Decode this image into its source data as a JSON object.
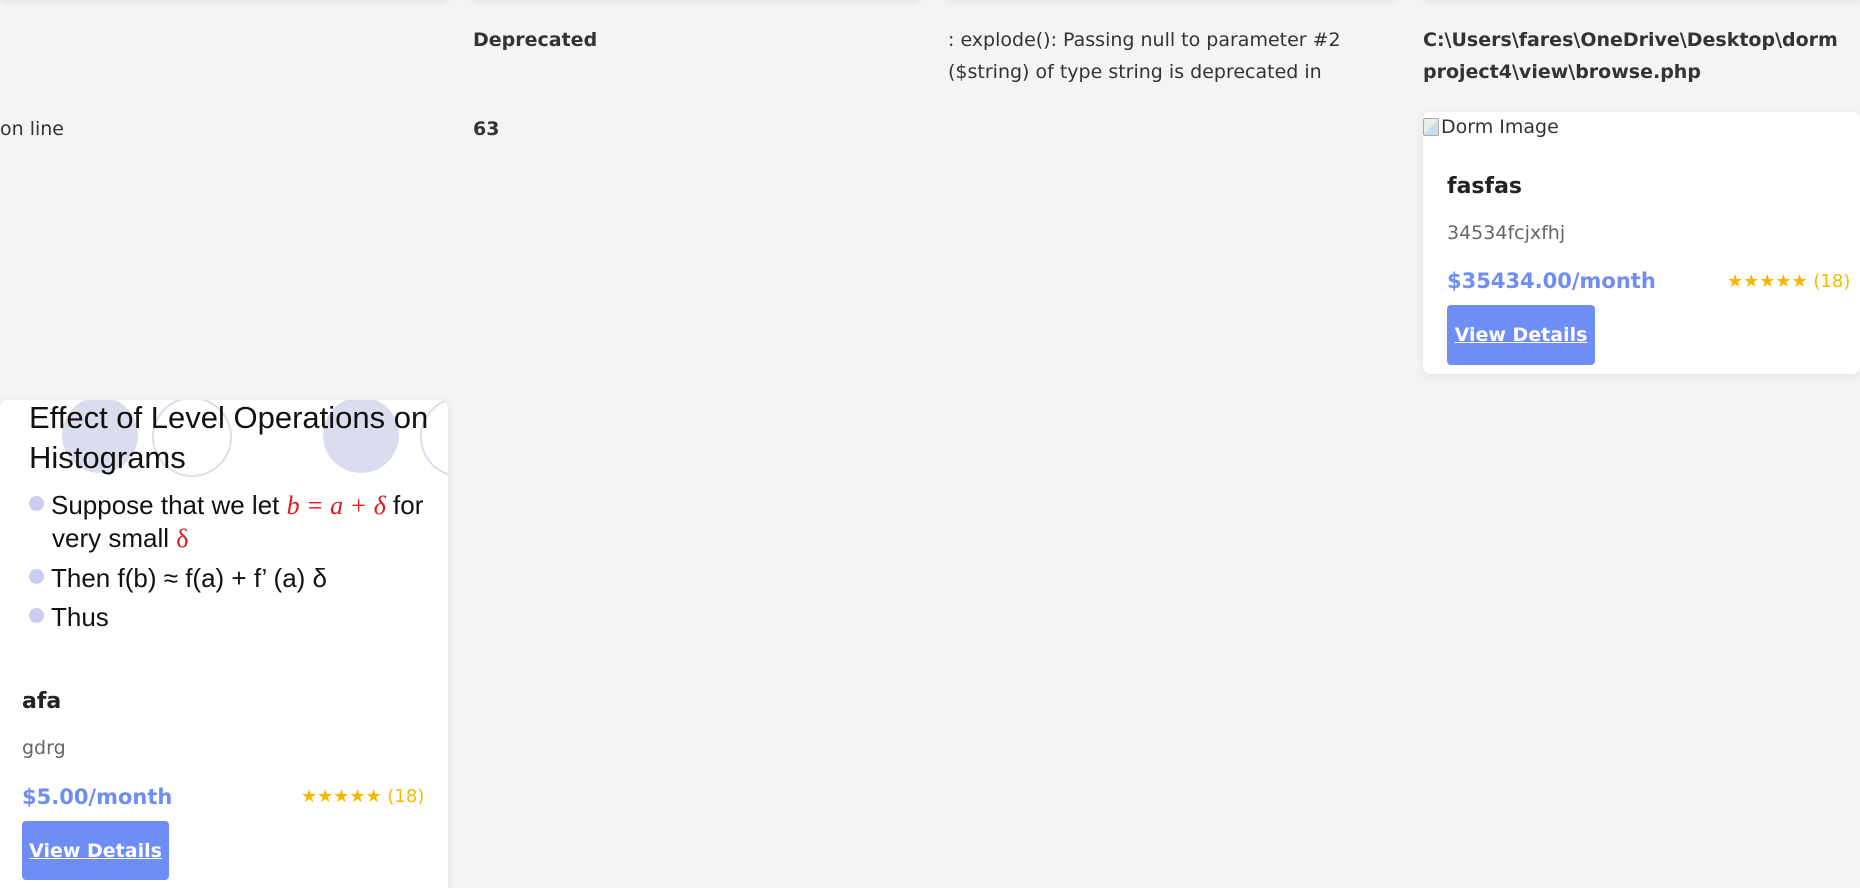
{
  "warning": {
    "frag_on_line": "on line",
    "type": "Deprecated",
    "message": ": explode(): Passing null to parameter #2 ($string) of type string is deprecated in",
    "path": "C:\\Users\\fares\\OneDrive\\Desktop\\dorm project4\\view\\browse.php",
    "line": "63"
  },
  "cards": [
    {
      "slide": {
        "title_line1": "Effect of Level Operations on",
        "title_line2": "Histograms",
        "bullet1_pre": "Suppose that we let ",
        "bullet1_eq": "b = a + δ",
        "bullet1_post": " for",
        "bullet1_line2_pre": "very small ",
        "bullet1_line2_delta": "δ",
        "bullet2": "Then f(b) ≈ f(a) + f’ (a) δ",
        "bullet3": "Thus"
      },
      "title": "afa",
      "description": "gdrg",
      "price": "$5.00/month",
      "rating": "★★★★★ (18)",
      "button": "View Details"
    },
    {
      "image_alt": "Dorm Image",
      "title": "fasfas",
      "description": "34534fcjxfhj",
      "price": "$35434.00/month",
      "rating": "★★★★★ (18)",
      "button": "View Details"
    }
  ],
  "colors": {
    "accent": "#6e8ef5",
    "star": "#f5b800",
    "background": "#f4f4f4"
  }
}
